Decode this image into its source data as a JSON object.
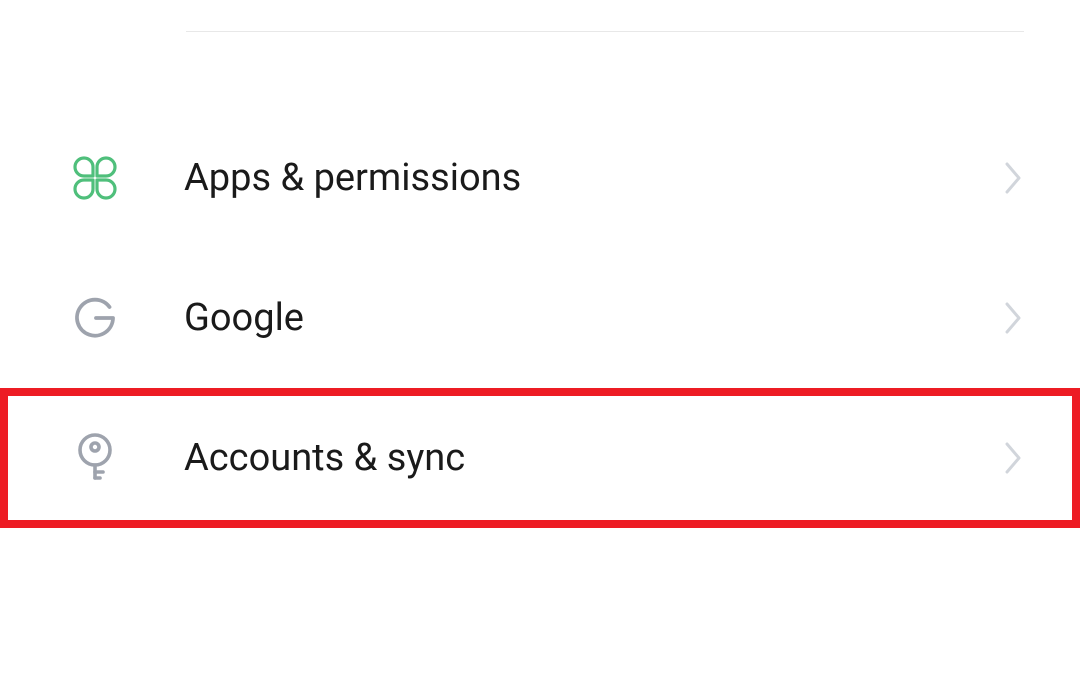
{
  "settings": {
    "items": [
      {
        "label": "Apps & permissions",
        "icon": "clover-icon",
        "iconColor": "#4fbf7b",
        "highlighted": false
      },
      {
        "label": "Google",
        "icon": "google-icon",
        "iconColor": "#9ea3ad",
        "highlighted": false
      },
      {
        "label": "Accounts & sync",
        "icon": "key-icon",
        "iconColor": "#9ea3ad",
        "highlighted": true
      }
    ]
  },
  "colors": {
    "chevron": "#d1d5db",
    "highlight": "#ed1c24"
  }
}
